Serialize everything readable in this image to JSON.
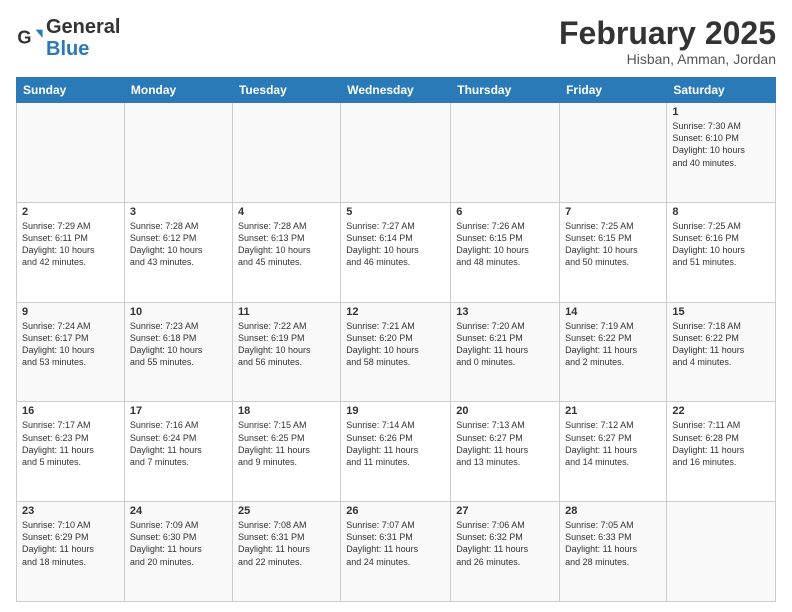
{
  "logo": {
    "general": "General",
    "blue": "Blue"
  },
  "header": {
    "title": "February 2025",
    "subtitle": "Hisban, Amman, Jordan"
  },
  "weekdays": [
    "Sunday",
    "Monday",
    "Tuesday",
    "Wednesday",
    "Thursday",
    "Friday",
    "Saturday"
  ],
  "weeks": [
    [
      {
        "day": "",
        "info": ""
      },
      {
        "day": "",
        "info": ""
      },
      {
        "day": "",
        "info": ""
      },
      {
        "day": "",
        "info": ""
      },
      {
        "day": "",
        "info": ""
      },
      {
        "day": "",
        "info": ""
      },
      {
        "day": "1",
        "info": "Sunrise: 7:30 AM\nSunset: 6:10 PM\nDaylight: 10 hours\nand 40 minutes."
      }
    ],
    [
      {
        "day": "2",
        "info": "Sunrise: 7:29 AM\nSunset: 6:11 PM\nDaylight: 10 hours\nand 42 minutes."
      },
      {
        "day": "3",
        "info": "Sunrise: 7:28 AM\nSunset: 6:12 PM\nDaylight: 10 hours\nand 43 minutes."
      },
      {
        "day": "4",
        "info": "Sunrise: 7:28 AM\nSunset: 6:13 PM\nDaylight: 10 hours\nand 45 minutes."
      },
      {
        "day": "5",
        "info": "Sunrise: 7:27 AM\nSunset: 6:14 PM\nDaylight: 10 hours\nand 46 minutes."
      },
      {
        "day": "6",
        "info": "Sunrise: 7:26 AM\nSunset: 6:15 PM\nDaylight: 10 hours\nand 48 minutes."
      },
      {
        "day": "7",
        "info": "Sunrise: 7:25 AM\nSunset: 6:15 PM\nDaylight: 10 hours\nand 50 minutes."
      },
      {
        "day": "8",
        "info": "Sunrise: 7:25 AM\nSunset: 6:16 PM\nDaylight: 10 hours\nand 51 minutes."
      }
    ],
    [
      {
        "day": "9",
        "info": "Sunrise: 7:24 AM\nSunset: 6:17 PM\nDaylight: 10 hours\nand 53 minutes."
      },
      {
        "day": "10",
        "info": "Sunrise: 7:23 AM\nSunset: 6:18 PM\nDaylight: 10 hours\nand 55 minutes."
      },
      {
        "day": "11",
        "info": "Sunrise: 7:22 AM\nSunset: 6:19 PM\nDaylight: 10 hours\nand 56 minutes."
      },
      {
        "day": "12",
        "info": "Sunrise: 7:21 AM\nSunset: 6:20 PM\nDaylight: 10 hours\nand 58 minutes."
      },
      {
        "day": "13",
        "info": "Sunrise: 7:20 AM\nSunset: 6:21 PM\nDaylight: 11 hours\nand 0 minutes."
      },
      {
        "day": "14",
        "info": "Sunrise: 7:19 AM\nSunset: 6:22 PM\nDaylight: 11 hours\nand 2 minutes."
      },
      {
        "day": "15",
        "info": "Sunrise: 7:18 AM\nSunset: 6:22 PM\nDaylight: 11 hours\nand 4 minutes."
      }
    ],
    [
      {
        "day": "16",
        "info": "Sunrise: 7:17 AM\nSunset: 6:23 PM\nDaylight: 11 hours\nand 5 minutes."
      },
      {
        "day": "17",
        "info": "Sunrise: 7:16 AM\nSunset: 6:24 PM\nDaylight: 11 hours\nand 7 minutes."
      },
      {
        "day": "18",
        "info": "Sunrise: 7:15 AM\nSunset: 6:25 PM\nDaylight: 11 hours\nand 9 minutes."
      },
      {
        "day": "19",
        "info": "Sunrise: 7:14 AM\nSunset: 6:26 PM\nDaylight: 11 hours\nand 11 minutes."
      },
      {
        "day": "20",
        "info": "Sunrise: 7:13 AM\nSunset: 6:27 PM\nDaylight: 11 hours\nand 13 minutes."
      },
      {
        "day": "21",
        "info": "Sunrise: 7:12 AM\nSunset: 6:27 PM\nDaylight: 11 hours\nand 14 minutes."
      },
      {
        "day": "22",
        "info": "Sunrise: 7:11 AM\nSunset: 6:28 PM\nDaylight: 11 hours\nand 16 minutes."
      }
    ],
    [
      {
        "day": "23",
        "info": "Sunrise: 7:10 AM\nSunset: 6:29 PM\nDaylight: 11 hours\nand 18 minutes."
      },
      {
        "day": "24",
        "info": "Sunrise: 7:09 AM\nSunset: 6:30 PM\nDaylight: 11 hours\nand 20 minutes."
      },
      {
        "day": "25",
        "info": "Sunrise: 7:08 AM\nSunset: 6:31 PM\nDaylight: 11 hours\nand 22 minutes."
      },
      {
        "day": "26",
        "info": "Sunrise: 7:07 AM\nSunset: 6:31 PM\nDaylight: 11 hours\nand 24 minutes."
      },
      {
        "day": "27",
        "info": "Sunrise: 7:06 AM\nSunset: 6:32 PM\nDaylight: 11 hours\nand 26 minutes."
      },
      {
        "day": "28",
        "info": "Sunrise: 7:05 AM\nSunset: 6:33 PM\nDaylight: 11 hours\nand 28 minutes."
      },
      {
        "day": "",
        "info": ""
      }
    ]
  ]
}
